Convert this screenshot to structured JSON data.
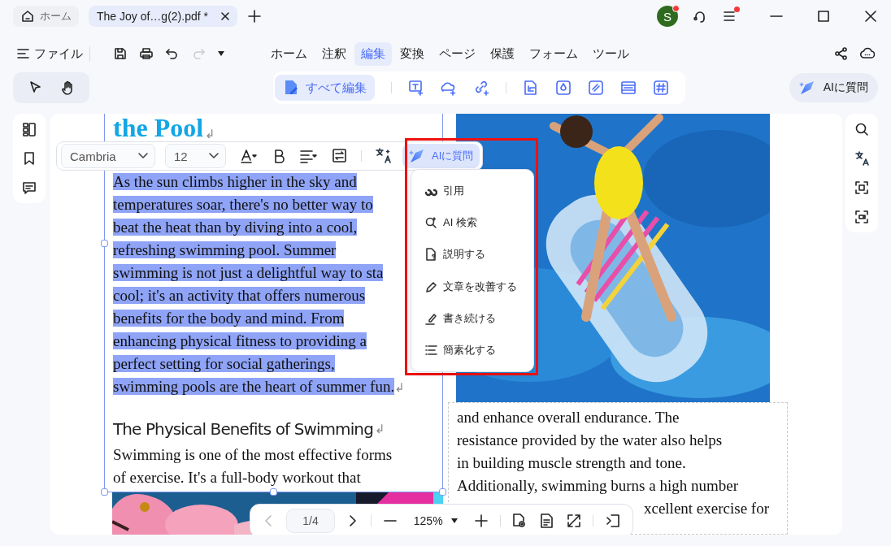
{
  "tabs": [
    {
      "label": "ホーム",
      "selected": false,
      "closable": false
    },
    {
      "label": "The Joy of…g(2).pdf *",
      "selected": true,
      "closable": true
    }
  ],
  "account": {
    "initial": "S",
    "badge": true
  },
  "app_menu": {
    "badge": true
  },
  "menu": {
    "file": "ファイル",
    "redo_disabled": true,
    "tabs": [
      {
        "label": "ホーム",
        "selected": false
      },
      {
        "label": "注釈",
        "selected": false
      },
      {
        "label": "編集",
        "selected": true
      },
      {
        "label": "変換",
        "selected": false
      },
      {
        "label": "ページ",
        "selected": false
      },
      {
        "label": "保護",
        "selected": false
      },
      {
        "label": "フォーム",
        "selected": false
      },
      {
        "label": "ツール",
        "selected": false
      }
    ]
  },
  "edit_toolbar": {
    "edit_all": "すべて編集",
    "ai_button": "AIに質問"
  },
  "format_bar": {
    "font": "Cambria",
    "size": "12",
    "ai_button": "AIに質問"
  },
  "ai_menu": [
    {
      "kind": "quote",
      "label": "引用"
    },
    {
      "kind": "search",
      "label": "AI 検索"
    },
    {
      "kind": "explain",
      "label": "説明する"
    },
    {
      "kind": "improve",
      "label": "文章を改善する"
    },
    {
      "kind": "continue",
      "label": "書き続ける"
    },
    {
      "kind": "simplify",
      "label": "簡素化する"
    }
  ],
  "document": {
    "mark": "↲",
    "title_fragment": "the Pool",
    "blocks": [
      {
        "kind": "paragraph",
        "selected": true,
        "lines": [
          "As the sun climbs higher in the sky and",
          "temperatures soar, there's no better way to",
          "beat the heat than by diving into a cool,",
          "refreshing swimming pool. Summer",
          "swimming is not just a delightful way to sta",
          "cool; it's an activity that offers numerous",
          "benefits for the body and mind. From",
          "enhancing physical fitness to providing a",
          "perfect setting for social gatherings,",
          "swimming pools are the heart of summer fun."
        ]
      },
      {
        "kind": "heading",
        "text": "The Physical Benefits of Swimming"
      },
      {
        "kind": "paragraph",
        "selected": false,
        "lines": [
          "Swimming is one of the most effective forms",
          "of exercise. It's a full-body workout that"
        ]
      }
    ],
    "right_lines": [
      "and enhance overall endurance. The",
      "resistance provided by the water also helps",
      "in building muscle strength and tone.",
      "Additionally, swimming burns a high number"
    ],
    "right_partial": "xcellent exercise for"
  },
  "page_nav": {
    "page": "1/4",
    "zoom": "125%"
  }
}
